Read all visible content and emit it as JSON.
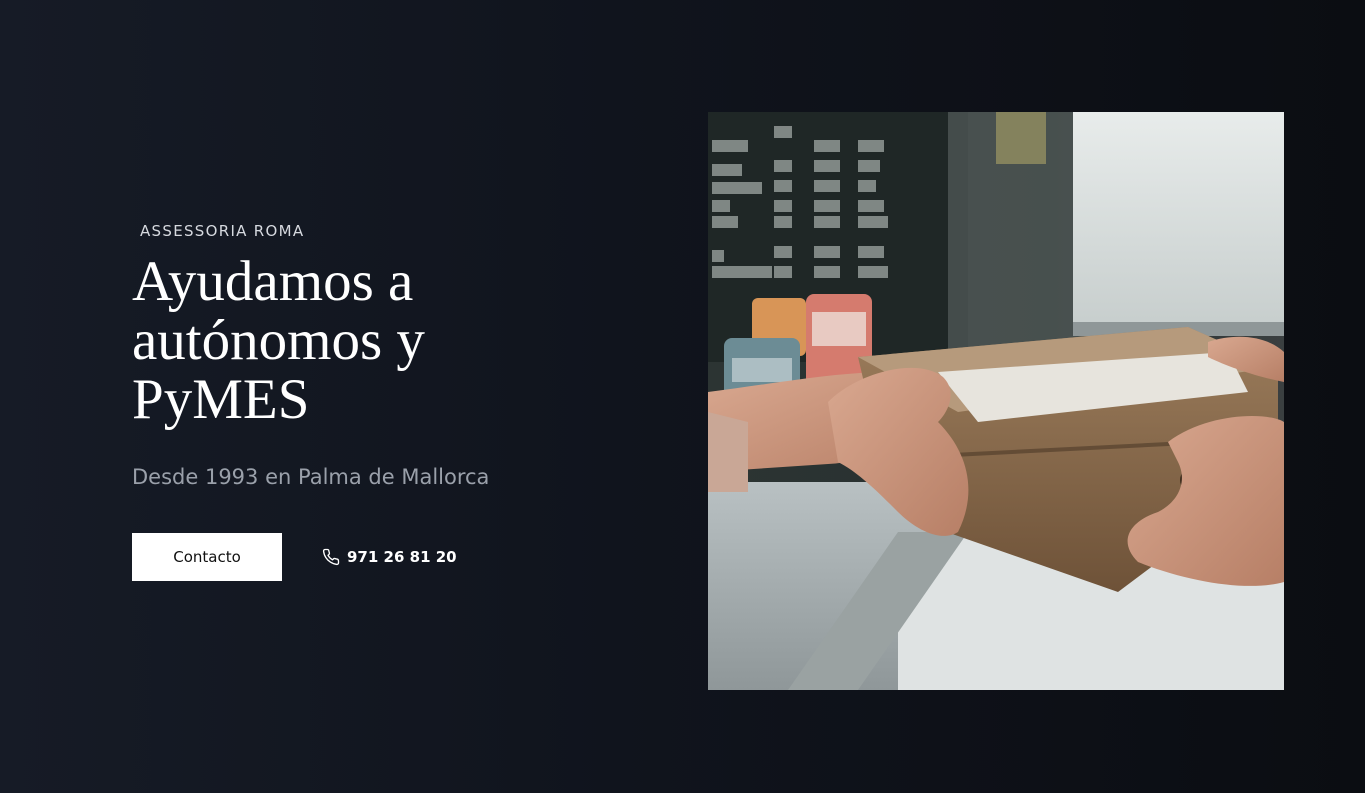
{
  "hero": {
    "eyebrow": "ASSESSORIA ROMA",
    "headline_line1": "Ayudamos a",
    "headline_line2": "autónomos y",
    "headline_line3": "PyMES",
    "subtitle": "Desde 1993 en Palma de Mallorca",
    "contact_button_label": "Contacto",
    "phone_number": "971 26 81 20",
    "phone_icon": "phone-icon",
    "image_subject": "hands-passing-cardboard-box-photo"
  },
  "colors": {
    "background": "#10141d",
    "button_bg": "#ffffff",
    "subtitle": "#9aa0aa"
  }
}
